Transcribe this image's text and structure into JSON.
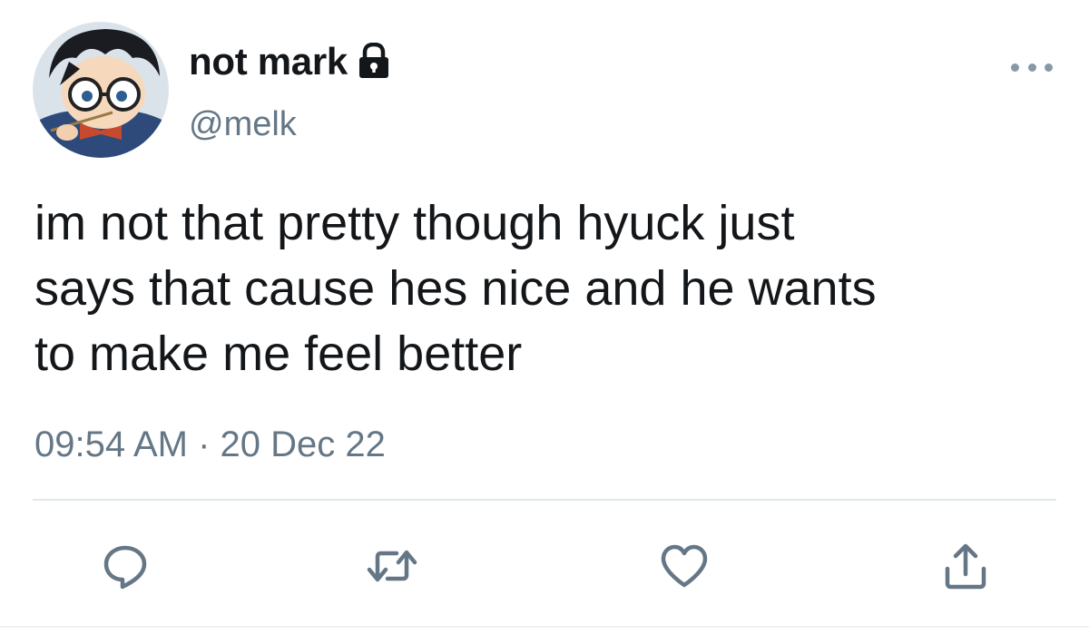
{
  "author": {
    "display_name": "not mark",
    "handle": "@melk",
    "protected_icon": "lock-icon",
    "avatar": "anime-boy-with-glasses-avatar"
  },
  "tweet": {
    "text": "im not that pretty though hyuck just\nsays that cause hes nice and he wants\nto make me feel better",
    "timestamp": "09:54 AM · 20 Dec 22"
  },
  "actions": [
    {
      "name": "reply",
      "icon": "reply-icon"
    },
    {
      "name": "retweet",
      "icon": "retweet-icon"
    },
    {
      "name": "like",
      "icon": "heart-icon"
    },
    {
      "name": "share",
      "icon": "share-icon"
    }
  ],
  "colors": {
    "text": "#14171a",
    "secondary": "#657786",
    "icon": "#657786",
    "divider": "#e1e8ed"
  }
}
